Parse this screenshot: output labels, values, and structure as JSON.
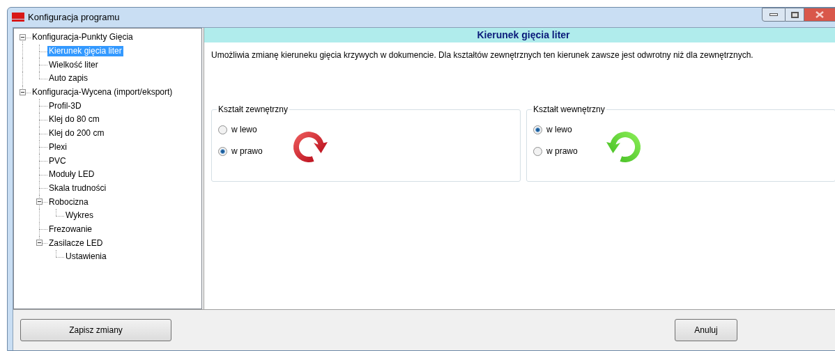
{
  "window": {
    "title": "Konfiguracja programu"
  },
  "tree": [
    {
      "label": "Konfiguracja-Punkty Gięcia",
      "selected": false,
      "expanded": true,
      "children": [
        {
          "label": "Kierunek gięcia liter",
          "selected": true
        },
        {
          "label": "Wielkość liter",
          "selected": false
        },
        {
          "label": "Auto zapis",
          "selected": false
        }
      ]
    },
    {
      "label": "Konfiguracja-Wycena (import/eksport)",
      "selected": false,
      "expanded": true,
      "children": [
        {
          "label": "Profil-3D",
          "selected": false
        },
        {
          "label": "Klej do 80 cm",
          "selected": false
        },
        {
          "label": "Klej do 200 cm",
          "selected": false
        },
        {
          "label": "Plexi",
          "selected": false
        },
        {
          "label": "PVC",
          "selected": false
        },
        {
          "label": "Moduły LED",
          "selected": false
        },
        {
          "label": "Skala trudności",
          "selected": false
        },
        {
          "label": "Robocizna",
          "selected": false,
          "expanded": true,
          "children": [
            {
              "label": "Wykres",
              "selected": false
            }
          ]
        },
        {
          "label": "Frezowanie",
          "selected": false
        },
        {
          "label": "Zasilacze LED",
          "selected": false,
          "expanded": true,
          "children": [
            {
              "label": "Ustawienia",
              "selected": false
            }
          ]
        }
      ]
    }
  ],
  "panel": {
    "title": "Kierunek gięcia liter",
    "description": "Umożliwia zmianę kieruneku gięcia krzywych w dokumencie. Dla kształtów zewnętrznych ten kierunek zawsze jest odwrotny niż dla zewnętrznych.",
    "groups": [
      {
        "title": "Kształt zewnętrzny",
        "options": [
          {
            "label": "w lewo",
            "selected": false
          },
          {
            "label": "w prawo",
            "selected": true
          }
        ]
      },
      {
        "title": "Kształt wewnętrzny",
        "options": [
          {
            "label": "w lewo",
            "selected": true
          },
          {
            "label": "w prawo",
            "selected": false
          }
        ]
      }
    ]
  },
  "buttons": {
    "save": "Zapisz zmiany",
    "cancel": "Anuluj"
  }
}
